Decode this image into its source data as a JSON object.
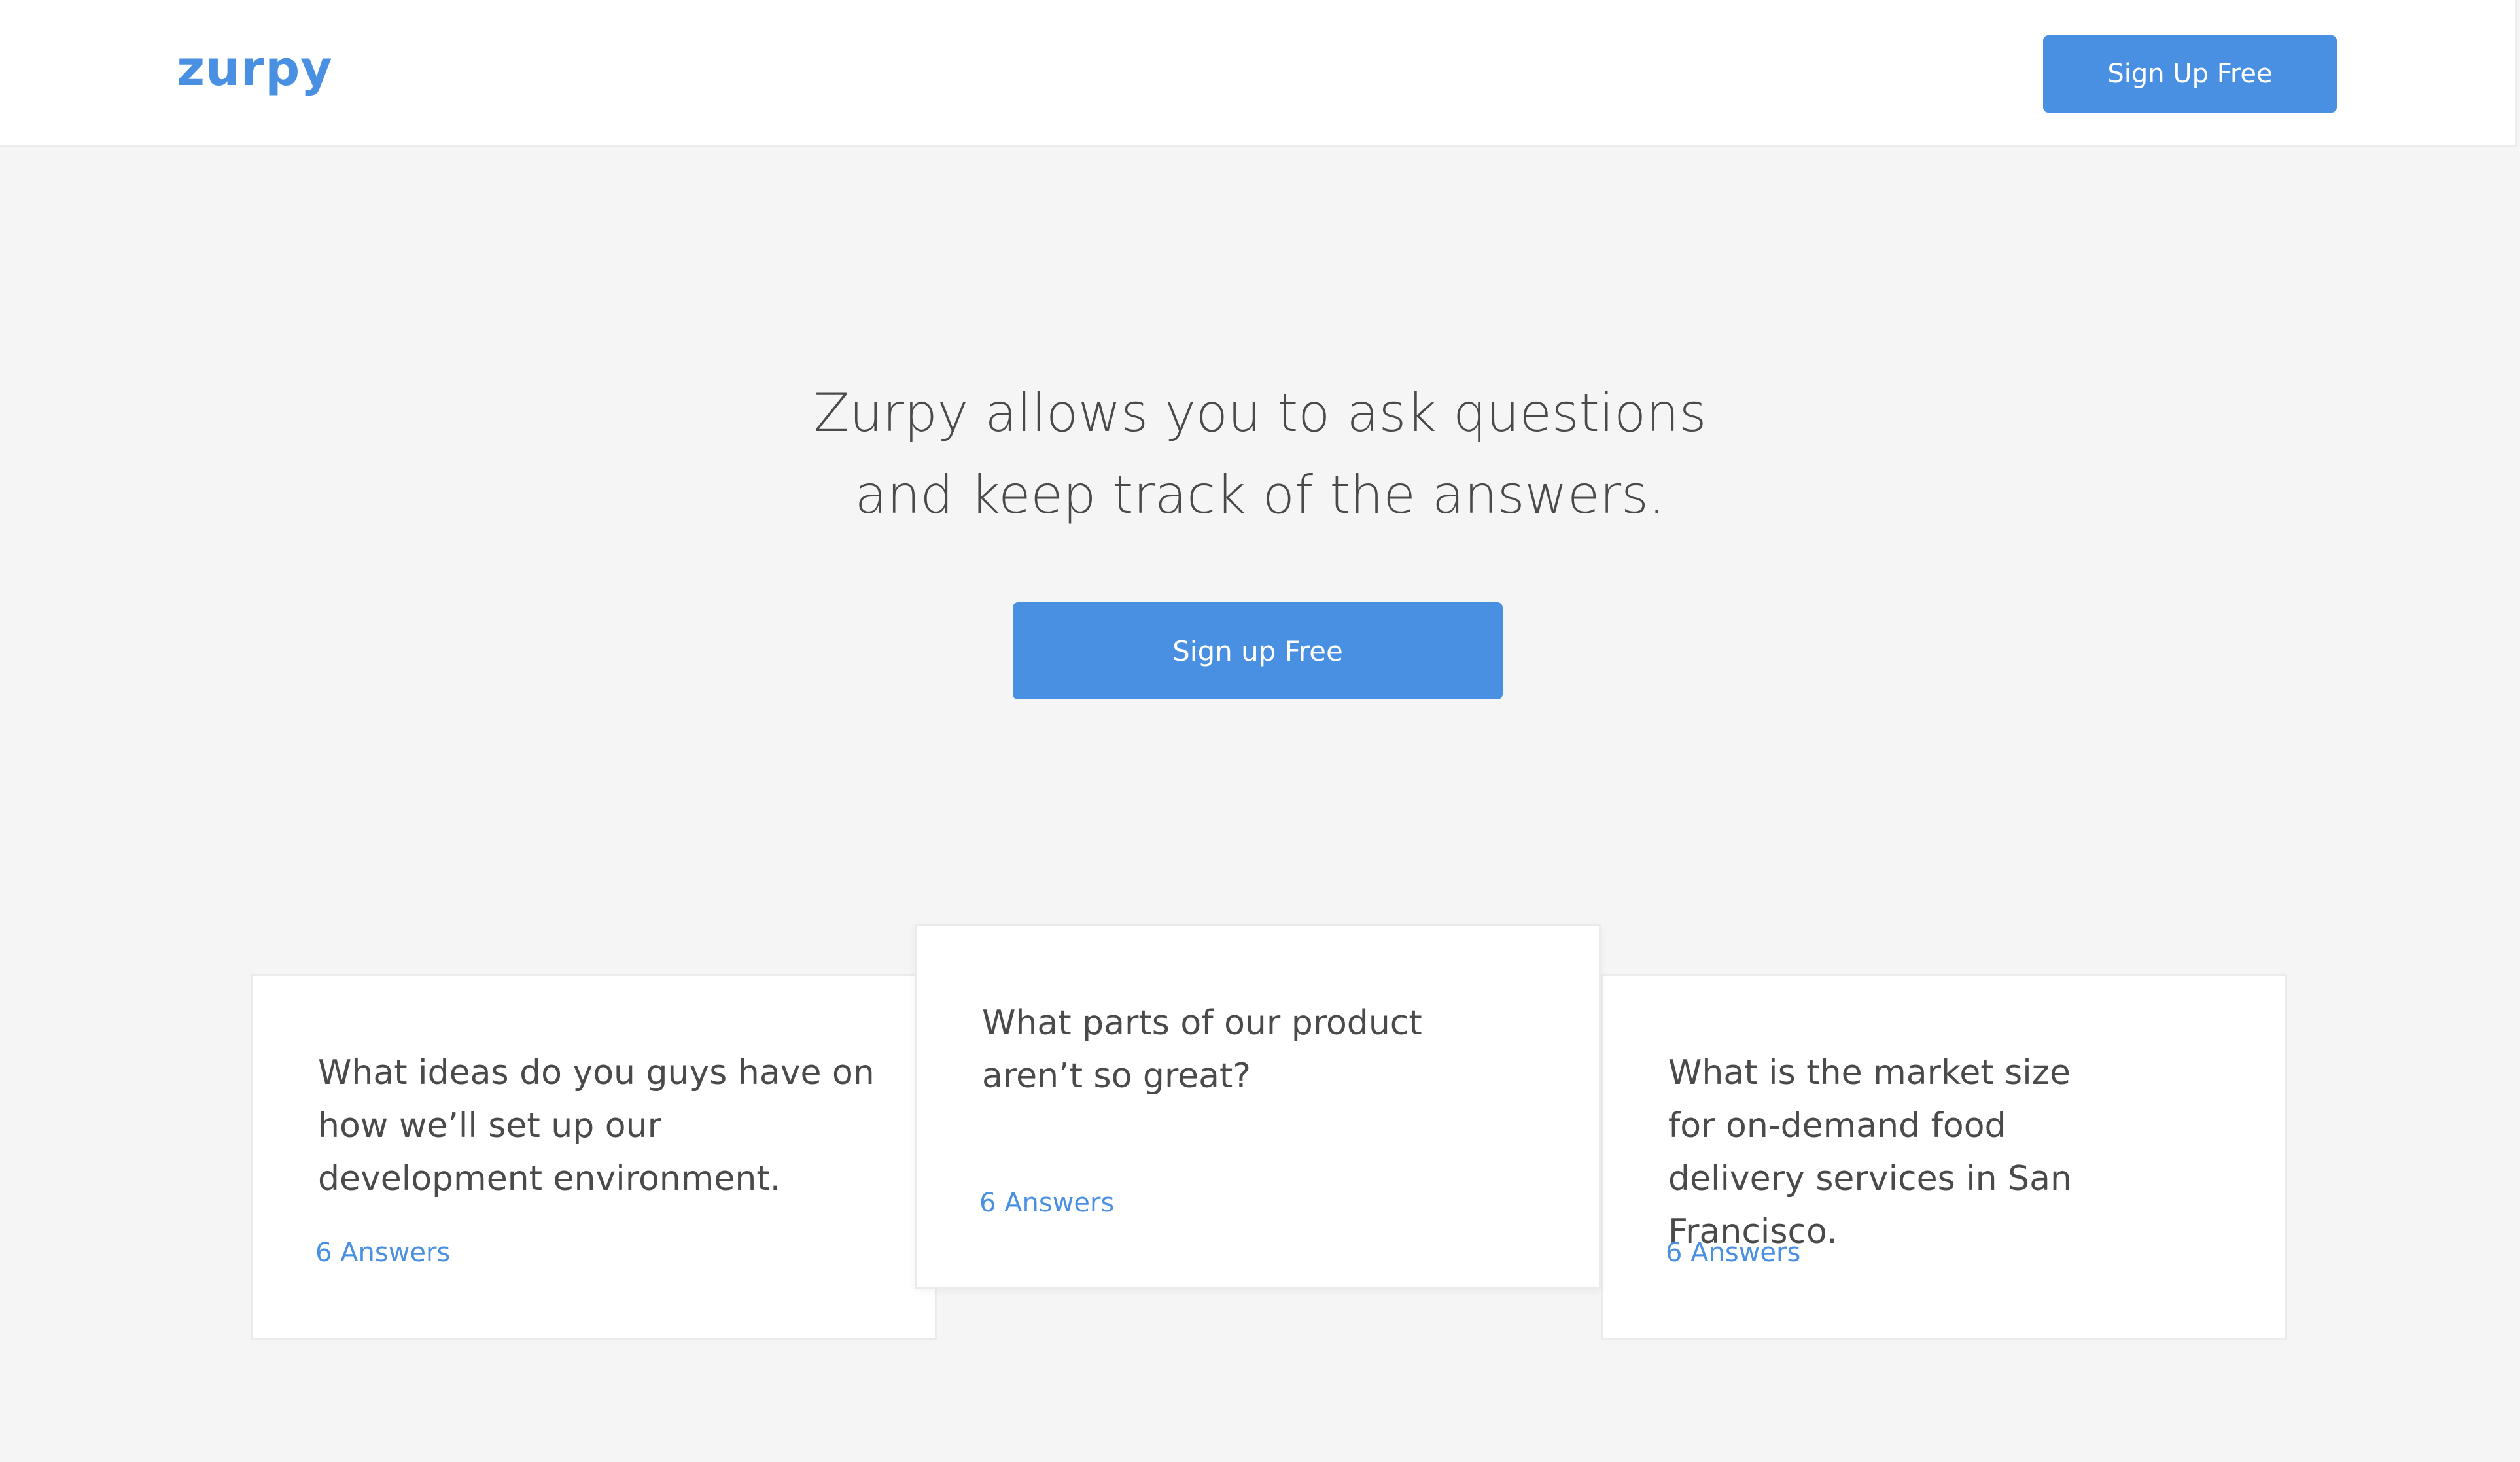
{
  "header": {
    "logo": "zurpy",
    "signup_label": "Sign Up Free"
  },
  "hero": {
    "line1": "Zurpy allows you to ask questions",
    "line2": "and keep track of the answers.",
    "signup_label": "Sign up Free"
  },
  "cards": [
    {
      "question": "What ideas do you guys have on how we’ll set up our development environment.",
      "answers": "6 Answers"
    },
    {
      "question": "What parts of our product aren’t so great?",
      "answers": "6 Answers"
    },
    {
      "question": "What is the market size for on-demand food delivery services in San Francisco.",
      "answers": "6 Answers"
    }
  ],
  "colors": {
    "accent": "#4a90e2",
    "background": "#f5f5f5",
    "text": "#4a4a4a"
  }
}
